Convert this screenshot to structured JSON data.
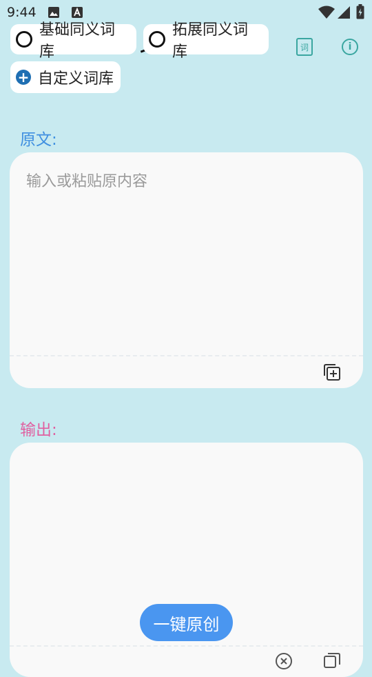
{
  "status_bar": {
    "time": "9:44"
  },
  "dictionaries": {
    "basic_label": "基础同义词库",
    "extended_label": "拓展同义词库",
    "custom_label": "自定义词库"
  },
  "top_icons": {
    "dict_glyph": "词",
    "info_glyph": "i"
  },
  "source": {
    "label": "原文:",
    "placeholder": "输入或粘贴原内容"
  },
  "output": {
    "label": "输出:"
  },
  "main_button": {
    "label": "一键原创"
  },
  "colors": {
    "background": "#c8eaf0",
    "source_label": "#3f8fe0",
    "output_label": "#e060a0",
    "accent_button": "#4a96f0",
    "icon_teal": "#3aa6a0"
  }
}
